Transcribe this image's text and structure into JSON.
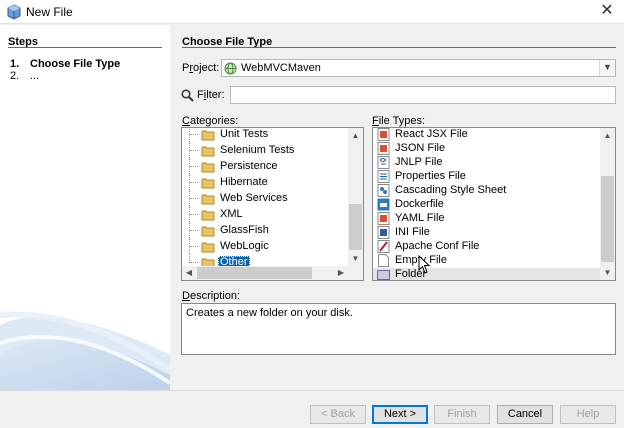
{
  "window": {
    "title": "New File",
    "icon": "netbeans-cube-icon",
    "close_glyph": "✕"
  },
  "steps": {
    "title": "Steps",
    "items": [
      {
        "num": "1.",
        "label": "Choose File Type"
      },
      {
        "num": "2.",
        "label": "..."
      }
    ]
  },
  "main": {
    "title": "Choose File Type",
    "project": {
      "label_pre": "P",
      "label_u": "r",
      "label_post": "oject:",
      "value": "WebMVCMaven"
    },
    "filter": {
      "label_pre": "F",
      "label_u": "i",
      "label_post": "lter:",
      "value": ""
    },
    "categories": {
      "label_pre": "",
      "label_u": "C",
      "label_post": "ategories:",
      "items": [
        "Unit Tests",
        "Selenium Tests",
        "Persistence",
        "Hibernate",
        "Web Services",
        "XML",
        "GlassFish",
        "WebLogic",
        "Other"
      ],
      "selected": "Other"
    },
    "file_types": {
      "label_pre": "",
      "label_u": "F",
      "label_post": "ile Types:",
      "items": [
        "React JSX File",
        "JSON File",
        "JNLP File",
        "Properties File",
        "Cascading Style Sheet",
        "Dockerfile",
        "YAML File",
        "INI File",
        "Apache Conf File",
        "Empty File",
        "Folder"
      ],
      "selected": "Folder"
    },
    "description": {
      "label_pre": "",
      "label_u": "D",
      "label_post": "escription:",
      "text": "Creates a new folder on your disk."
    }
  },
  "buttons": {
    "back": "< Back",
    "next": "Next >",
    "finish": "Finish",
    "cancel": "Cancel",
    "help": "Help"
  },
  "colors": {
    "selection": "#0a64ad",
    "default_button_border": "#0078d7"
  }
}
